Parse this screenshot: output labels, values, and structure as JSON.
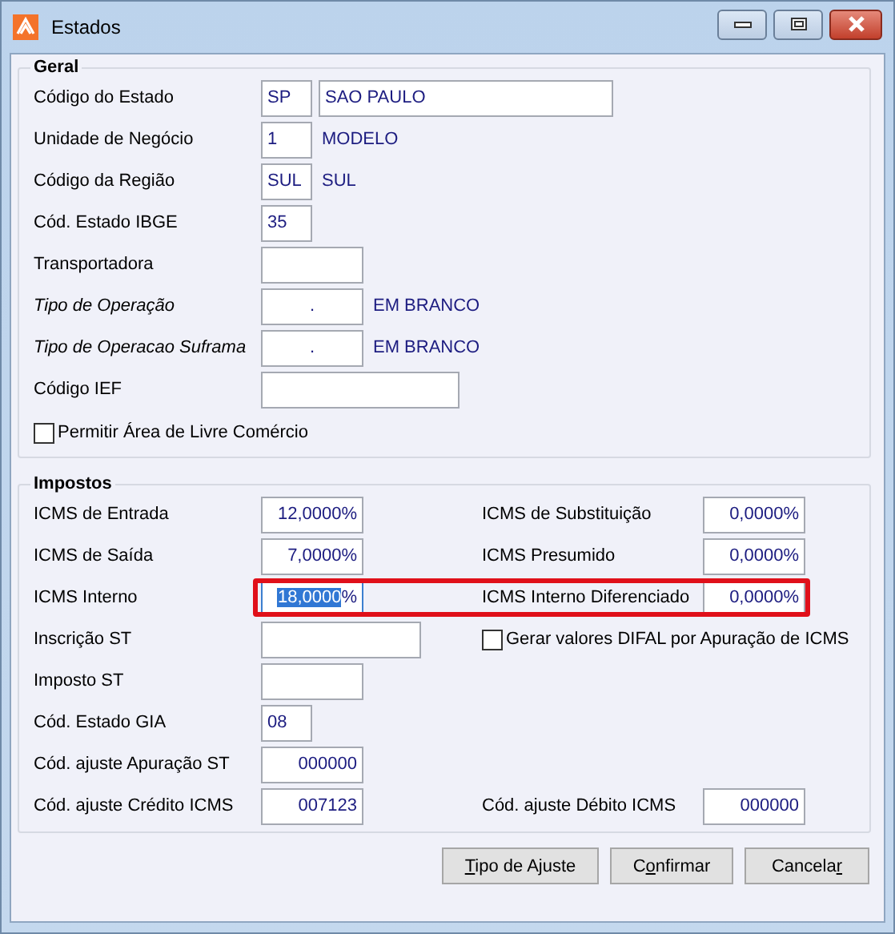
{
  "window": {
    "title": "Estados"
  },
  "geral": {
    "title": "Geral",
    "rows": [
      {
        "label": "Código do Estado",
        "italic": false,
        "fields": [
          {
            "value": "SP",
            "kind": "tiny"
          },
          {
            "value": "SAO PAULO",
            "kind": "wide"
          }
        ]
      },
      {
        "label": "Unidade de Negócio",
        "italic": false,
        "fields": [
          {
            "value": "1",
            "kind": "tiny"
          }
        ],
        "note": "MODELO"
      },
      {
        "label": "Código da Região",
        "italic": false,
        "fields": [
          {
            "value": "SUL",
            "kind": "tiny"
          }
        ],
        "note": "SUL"
      },
      {
        "label": "Cód. Estado IBGE",
        "italic": false,
        "fields": [
          {
            "value": "35",
            "kind": "tiny"
          }
        ]
      },
      {
        "label": "Transportadora",
        "italic": false,
        "fields": [
          {
            "kind": "short"
          }
        ]
      },
      {
        "label": "Tipo de Operação",
        "italic": true,
        "fields": [
          {
            "value": ".",
            "kind": "dot"
          }
        ],
        "note": "EM BRANCO"
      },
      {
        "label": "Tipo de Operacao Suframa",
        "italic": true,
        "fields": [
          {
            "value": ".",
            "kind": "dot"
          }
        ],
        "note": "EM BRANCO"
      },
      {
        "label": "Código IEF",
        "italic": false,
        "fields": [
          {
            "kind": "long"
          }
        ]
      }
    ],
    "checkbox": {
      "label": "Permitir Área de Livre Comércio",
      "checked": false
    }
  },
  "impostos": {
    "title": "Impostos",
    "rows": [
      {
        "highlighted": false,
        "left": {
          "label": "ICMS de Entrada",
          "field": {
            "value": "12,0000",
            "unit": "%",
            "kind": "amount",
            "text_selected": false
          }
        },
        "right": {
          "kind": "field",
          "label": "ICMS de Substituição",
          "field": {
            "value": "0,0000",
            "unit": "%",
            "kind": "amount",
            "text_selected": false
          }
        }
      },
      {
        "highlighted": false,
        "left": {
          "label": "ICMS de Saída",
          "field": {
            "value": "7,0000",
            "unit": "%",
            "kind": "amount",
            "text_selected": false
          }
        },
        "right": {
          "kind": "field",
          "label": "ICMS Presumido",
          "field": {
            "value": "0,0000",
            "unit": "%",
            "kind": "amount",
            "text_selected": false
          }
        }
      },
      {
        "highlighted": true,
        "left": {
          "label": "ICMS Interno",
          "field": {
            "value": "18,0000",
            "unit": "%",
            "kind": "amount",
            "text_selected": true
          }
        },
        "right": {
          "kind": "field",
          "label": "ICMS Interno Diferenciado",
          "field": {
            "value": "0,0000",
            "unit": "%",
            "kind": "amount",
            "text_selected": false
          }
        }
      },
      {
        "highlighted": false,
        "left": {
          "label": "Inscrição ST",
          "field": {
            "kind": "medium",
            "text_selected": false
          }
        },
        "right": {
          "kind": "checkbox",
          "label": "Gerar valores DIFAL por Apuração de ICMS",
          "checked": false
        }
      },
      {
        "highlighted": false,
        "left": {
          "label": "Imposto ST",
          "field": {
            "kind": "short",
            "text_selected": false
          }
        }
      },
      {
        "highlighted": false,
        "left": {
          "label": "Cód. Estado GIA",
          "field": {
            "value": "08",
            "kind": "tiny",
            "text_selected": false
          }
        }
      },
      {
        "highlighted": false,
        "left": {
          "label": "Cód. ajuste Apuração ST",
          "field": {
            "value": "000000",
            "kind": "amount",
            "text_selected": false
          }
        }
      },
      {
        "highlighted": false,
        "left": {
          "label": "Cód. ajuste Crédito ICMS",
          "field": {
            "value": "007123",
            "kind": "amount",
            "text_selected": false
          }
        },
        "right": {
          "kind": "field",
          "label": "Cód. ajuste Débito ICMS",
          "field": {
            "value": "000000",
            "kind": "amount",
            "text_selected": false
          }
        }
      }
    ]
  },
  "buttons": [
    {
      "key": "T",
      "after": "ipo de Ajuste"
    },
    {
      "before": "C",
      "key": "o",
      "after": "nfirmar"
    },
    {
      "before": "Cancela",
      "key": "r"
    }
  ]
}
